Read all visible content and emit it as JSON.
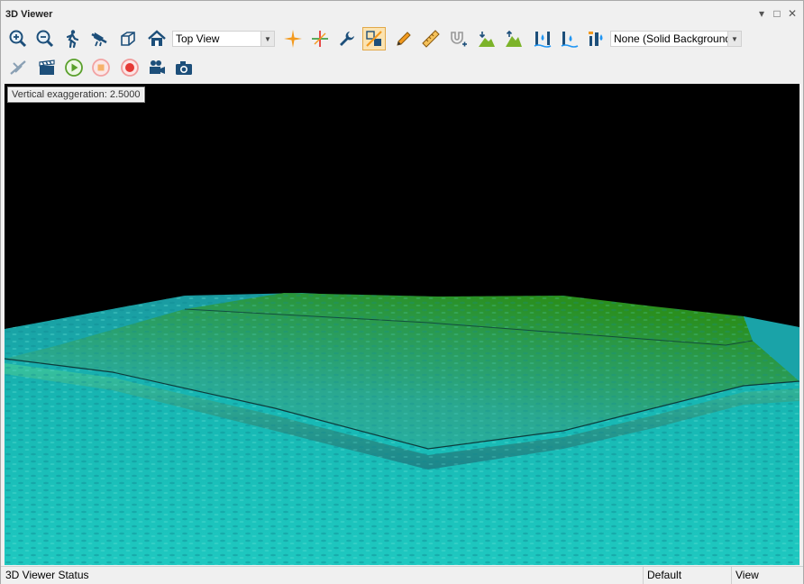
{
  "window": {
    "title": "3D Viewer"
  },
  "toolbar": {
    "view_select": "Top View",
    "background_select": "None (Solid Background",
    "row1_icons": [
      "zoom-in-icon",
      "zoom-out-icon",
      "walk-icon",
      "fly-icon",
      "box-icon",
      "home-icon",
      "crosshair-star-icon",
      "crosshair-icon",
      "wrench-icon",
      "terrain-toggle-icon",
      "pencil-icon",
      "ruler-icon",
      "magnet-icon",
      "terrain-lower-icon",
      "terrain-raise-icon",
      "water-level-icon",
      "water-lower-icon",
      "water-tower-icon"
    ],
    "row2_icons": [
      "plane-icon",
      "clapperboard-icon",
      "play-icon",
      "stop-icon",
      "record-icon",
      "video-camera-icon",
      "photo-camera-icon"
    ],
    "active_tool": "terrain-toggle-icon"
  },
  "viewport": {
    "exaggeration_label": "Vertical exaggeration: 2.5000",
    "background_color": "#000000",
    "terrain_colors": {
      "low": "#1ec8c0",
      "mid": "#2aa890",
      "high": "#2a8f1e"
    }
  },
  "status": {
    "text": "3D Viewer Status",
    "mode": "Default",
    "view": "View"
  }
}
